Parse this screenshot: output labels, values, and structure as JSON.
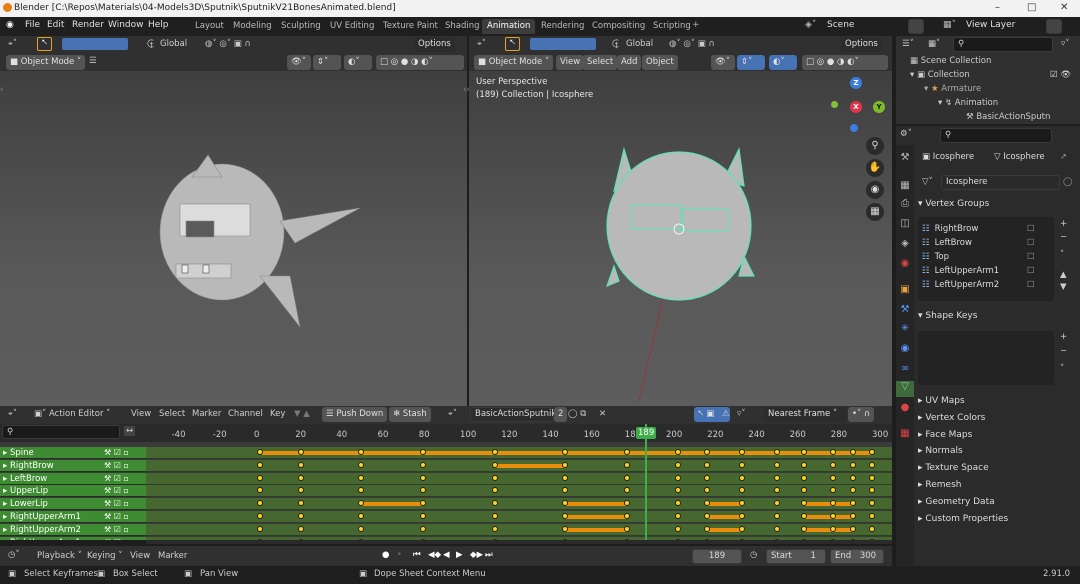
{
  "titlebar": {
    "title": "Blender [C:\\Repos\\Materials\\04-Models3D\\Sputnik\\SputnikV21BonesAnimated.blend]",
    "minimize": "–",
    "maximize": "□",
    "close": "✕"
  },
  "menu": {
    "file": "File",
    "edit": "Edit",
    "render": "Render",
    "window": "Window",
    "help": "Help"
  },
  "workspaces": [
    "Layout",
    "Modeling",
    "Sculpting",
    "UV Editing",
    "Texture Paint",
    "Shading",
    "Animation",
    "Rendering",
    "Compositing",
    "Scripting"
  ],
  "add_ws": "+",
  "scene": {
    "label": "Scene",
    "view_layer": "View Layer"
  },
  "left_vp": {
    "transform": "Global",
    "options": "Options",
    "mode": "Object Mode"
  },
  "right_vp": {
    "transform": "Global",
    "options": "Options",
    "mode": "Object Mode",
    "view": "View",
    "select": "Select",
    "add": "Add",
    "object": "Object",
    "perspective": "User Perspective",
    "collection_info": "(189) Collection | Icosphere",
    "gizmo_z": "Z",
    "gizmo_x": "X",
    "gizmo_y": "Y"
  },
  "outliner": {
    "scene_collection": "Scene Collection",
    "collection": "Collection",
    "armature": "Armature",
    "animation": "Animation",
    "action": "BasicActionSputn"
  },
  "properties": {
    "object": "Icosphere",
    "data": "Icosphere",
    "mesh_name": "Icosphere",
    "vertex_groups": "Vertex Groups",
    "groups": [
      "RightBrow",
      "LeftBrow",
      "Top",
      "LeftUpperArm1",
      "LeftUpperArm2"
    ],
    "shape_keys": "Shape Keys",
    "sections": [
      "UV Maps",
      "Vertex Colors",
      "Face Maps",
      "Normals",
      "Texture Space",
      "Remesh",
      "Geometry Data",
      "Custom Properties"
    ]
  },
  "action_editor": {
    "mode": "Action Editor",
    "view": "View",
    "select": "Select",
    "marker": "Marker",
    "channel": "Channel",
    "key": "Key",
    "push_down": "Push Down",
    "stash": "Stash",
    "action": "BasicActionSputnik",
    "users": "2",
    "snap": "Nearest Frame",
    "current_frame": "189"
  },
  "ruler": [
    "-40",
    "-20",
    "0",
    "20",
    "40",
    "60",
    "80",
    "100",
    "120",
    "140",
    "160",
    "180",
    "200",
    "220",
    "240",
    "260",
    "280",
    "300"
  ],
  "channels": [
    "Spine",
    "RightBrow",
    "LeftBrow",
    "UpperLip",
    "LowerLip",
    "RightUpperArm1",
    "RightUpperArm2",
    "RightLowerArm1"
  ],
  "timeline": {
    "playback": "Playback",
    "keying": "Keying",
    "view": "View",
    "marker": "Marker",
    "frame": "189",
    "start_label": "Start",
    "start": "1",
    "end_label": "End",
    "end": "300"
  },
  "status": {
    "select_keyframes": "Select Keyframes",
    "box_select": "Box Select",
    "pan_view": "Pan View",
    "context_menu": "Dope Sheet Context Menu",
    "version": "2.91.0"
  },
  "colors": {
    "accent": "#4772b3",
    "keyframe": "#ffd31a",
    "channel_green": "#3e8c31",
    "current_frame": "#3fae4a",
    "active_tab": "#3d3d3d"
  }
}
